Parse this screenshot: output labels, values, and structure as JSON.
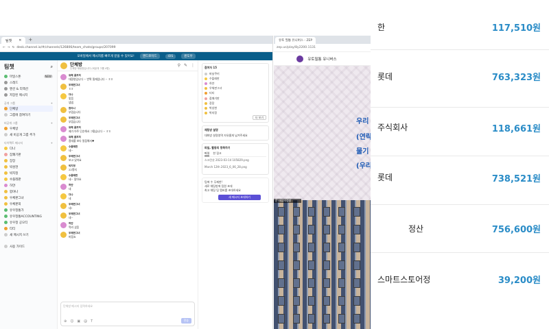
{
  "left_browser": {
    "tab_label": "팀챗",
    "url": "desk.channel.io/#/channels/126806/team_chats/groups/207099",
    "banner": "모바일에서 메시지를 빠르게 받을 수 있어요!",
    "banner_buttons": [
      "앤드로이드",
      "iOS",
      "윈도우"
    ]
  },
  "sidebar": {
    "title": "팀챗",
    "items": [
      {
        "label": "마일스톤",
        "badge": "NEW"
      },
      {
        "label": "스레드",
        "badge": ""
      },
      {
        "label": "멘션 & 리액션",
        "badge": ""
      },
      {
        "label": "저장된 메시지",
        "badge": ""
      }
    ],
    "section_public": "공개 그룹",
    "public_groups": [
      {
        "label": "단체방"
      },
      {
        "label": "그룹에 참여하기"
      }
    ],
    "section_private": "비공개 그룹",
    "private_groups": [
      {
        "label": "우체방"
      },
      {
        "label": "새 비공개 그룹 추가"
      }
    ],
    "section_dm": "다이렉트 메시지",
    "dms": [
      {
        "label": "다나"
      },
      {
        "label": "잠쾌기판"
      },
      {
        "label": "장장"
      },
      {
        "label": "박성현"
      },
      {
        "label": "박지정"
      },
      {
        "label": "수플레판"
      },
      {
        "label": "하얀"
      },
      {
        "label": "합야나"
      },
      {
        "label": "우체판그녀"
      },
      {
        "label": "우체판희"
      },
      {
        "label": "유우정통가"
      },
      {
        "label": "유우정통ACCOUNTING"
      },
      {
        "label": "유우정 공오티"
      },
      {
        "label": "티티"
      },
      {
        "label": "새 메시지 쓰기"
      }
    ],
    "footer": "사용 가이드"
  },
  "chat": {
    "title": "단체방",
    "subtitle": "단체방 채팅방입니다 (비공개 그룹 4명)",
    "messages": [
      {
        "name": "유혜 골프처",
        "text": "대환영입니다 ~ 반짝 필재입니다 ~ ㅎㅎ",
        "color": "#d98bd0"
      },
      {
        "name": "우체판그녀",
        "text": "ㅎㅎ",
        "color": "#f0c040"
      },
      {
        "name": "다나",
        "text": "맞음\n넵넵",
        "color": "#f5c842"
      },
      {
        "name": "합야나",
        "text": "부럽습니다",
        "color": "#f0c040"
      },
      {
        "name": "우체판그녀",
        "text": "부럽습니다",
        "color": "#f0c040"
      },
      {
        "name": "유혜 골프처",
        "text": "제가 아주 단순해서 그렇습니다 ~ ㅎㅎ",
        "color": "#d98bd0"
      },
      {
        "name": "유혜 골프처",
        "text": "증대를 보다 밀접해서♥",
        "color": "#d98bd0"
      },
      {
        "name": "수플레판",
        "text": "네~",
        "color": "#f5c842"
      },
      {
        "name": "우체판그녀",
        "text": "보고 있어요",
        "color": "#f0c040"
      },
      {
        "name": "박지정",
        "text": "22명지",
        "color": "#f0c040"
      },
      {
        "name": "수플레판",
        "text": "네~ 맞아요",
        "color": "#f5c842"
      },
      {
        "name": "하얀",
        "text": "네",
        "color": "#d98bd0"
      },
      {
        "name": "다나",
        "text": "네",
        "color": "#f5c842"
      },
      {
        "name": "우체판그녀",
        "text": "네!",
        "color": "#f0c040"
      },
      {
        "name": "우체판그녀",
        "text": "네~",
        "color": "#f0c040"
      },
      {
        "name": "하얀",
        "text": "먹러 섰음",
        "color": "#d98bd0"
      },
      {
        "name": "우체판그녀",
        "text": "마힙죠",
        "color": "#f0c040"
      }
    ],
    "composer_placeholder": "단체방 메시지 입력하세요",
    "send_label": "전송"
  },
  "right_panel": {
    "members_title": "참여자 15",
    "members": [
      "바닐쿠키",
      "수플레판",
      "하얀",
      "우체판그녀",
      "티티",
      "잠쾌기판",
      "장장",
      "박성현",
      "박지정"
    ],
    "more_label": "더 보기",
    "desc_title": "채팅방 설명",
    "desc_text": "대화방 설명영역 자유롭게 남겨주세요",
    "files_title": "파일, 활동의 항목하기",
    "tabs": [
      "파일",
      "한 링크"
    ],
    "files": [
      "스크린샷 2023-03-14 105829.png",
      "March 12th 2023_6_06_28.png"
    ],
    "invite_text": "팀에 수 무제한!\n새로 채팅방에 팀원 초대\n최고 채팅 팀 멤버를 초대하세요",
    "invite_button": "새 메시지 초대하기"
  },
  "right_browser": {
    "tab_label": "유토 필통 유니버스 - ZEP",
    "url": "zep.us/play/8y2200.1131",
    "site_title": "유토필통 유니버스",
    "map_label": "문 대임의정방"
  },
  "overlay_partial": [
    "우리",
    "(연락",
    "물기",
    "(우리"
  ],
  "overlay": [
    {
      "name": "한",
      "amount": "117,510원"
    },
    {
      "name": "롯데",
      "amount": "763,323원"
    },
    {
      "name": "주식회사",
      "amount": "118,661원"
    },
    {
      "name": "롯데",
      "amount": "738,521원"
    },
    {
      "name": "정산",
      "amount": "756,600원"
    },
    {
      "name": "스마트스토어정",
      "amount": "39,200원"
    }
  ]
}
